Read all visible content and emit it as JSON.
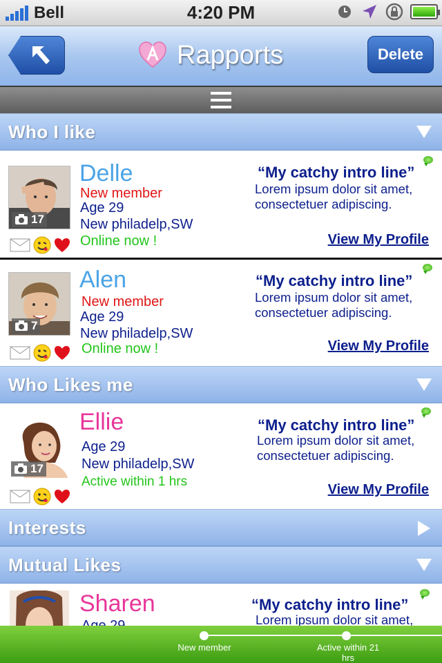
{
  "status_bar": {
    "carrier": "Bell",
    "time": "4:20 PM"
  },
  "nav": {
    "title": "Rapports",
    "delete_label": "Delete"
  },
  "sections": {
    "who_i_like": "Who I like",
    "who_likes_me": "Who Likes me",
    "interests": "Interests",
    "mutual_likes": "Mutual Likes"
  },
  "profiles": [
    {
      "name": "Delle",
      "name_color": "#4aa3e6",
      "badge": "New member",
      "age": "Age 29",
      "location": "New philadelp,SW",
      "status": "Online now !",
      "photo_count": "17",
      "intro": "“My catchy intro line”",
      "desc": "Lorem ipsum dolor sit amet, consectetuer adipiscing.",
      "link": "View My Profile"
    },
    {
      "name": "Alen",
      "name_color": "#4aa3e6",
      "badge": "New member",
      "age": "Age 29",
      "location": "New philadelp,SW",
      "status": "Online now !",
      "photo_count": "7",
      "intro": "“My catchy intro line”",
      "desc": "Lorem ipsum dolor sit amet, consectetuer adipiscing.",
      "link": "View My Profile"
    },
    {
      "name": "Ellie",
      "name_color": "#e8369a",
      "age": "Age 29",
      "location": "New philadelp,SW",
      "status": "Active within 1 hrs",
      "photo_count": "17",
      "intro": "“My catchy intro line”",
      "desc": "Lorem ipsum dolor sit amet, consectetuer adipiscing.",
      "link": "View My Profile"
    },
    {
      "name": "Sharen",
      "name_color": "#e8369a",
      "age": "Age 29",
      "intro": "“My catchy intro line”",
      "desc": "Lorem ipsum dolor sit amet,"
    }
  ],
  "colors": {
    "badge": "#e01616",
    "status": "#22c51a",
    "text": "#0d1f8c",
    "accent": "#1f4fa6"
  },
  "bottom_bar": {
    "stop1": "New member",
    "stop2": "Active within 21 hrs"
  },
  "icons": [
    "signal-icon",
    "clock-icon",
    "location-arrow-icon",
    "rotation-lock-icon",
    "battery-icon",
    "back-arrow-icon",
    "logo-icon",
    "menu-icon",
    "chevron-down-icon",
    "chevron-right-icon",
    "camera-icon",
    "mail-icon",
    "smiley-icon",
    "heart-icon",
    "chat-bubble-icon"
  ]
}
